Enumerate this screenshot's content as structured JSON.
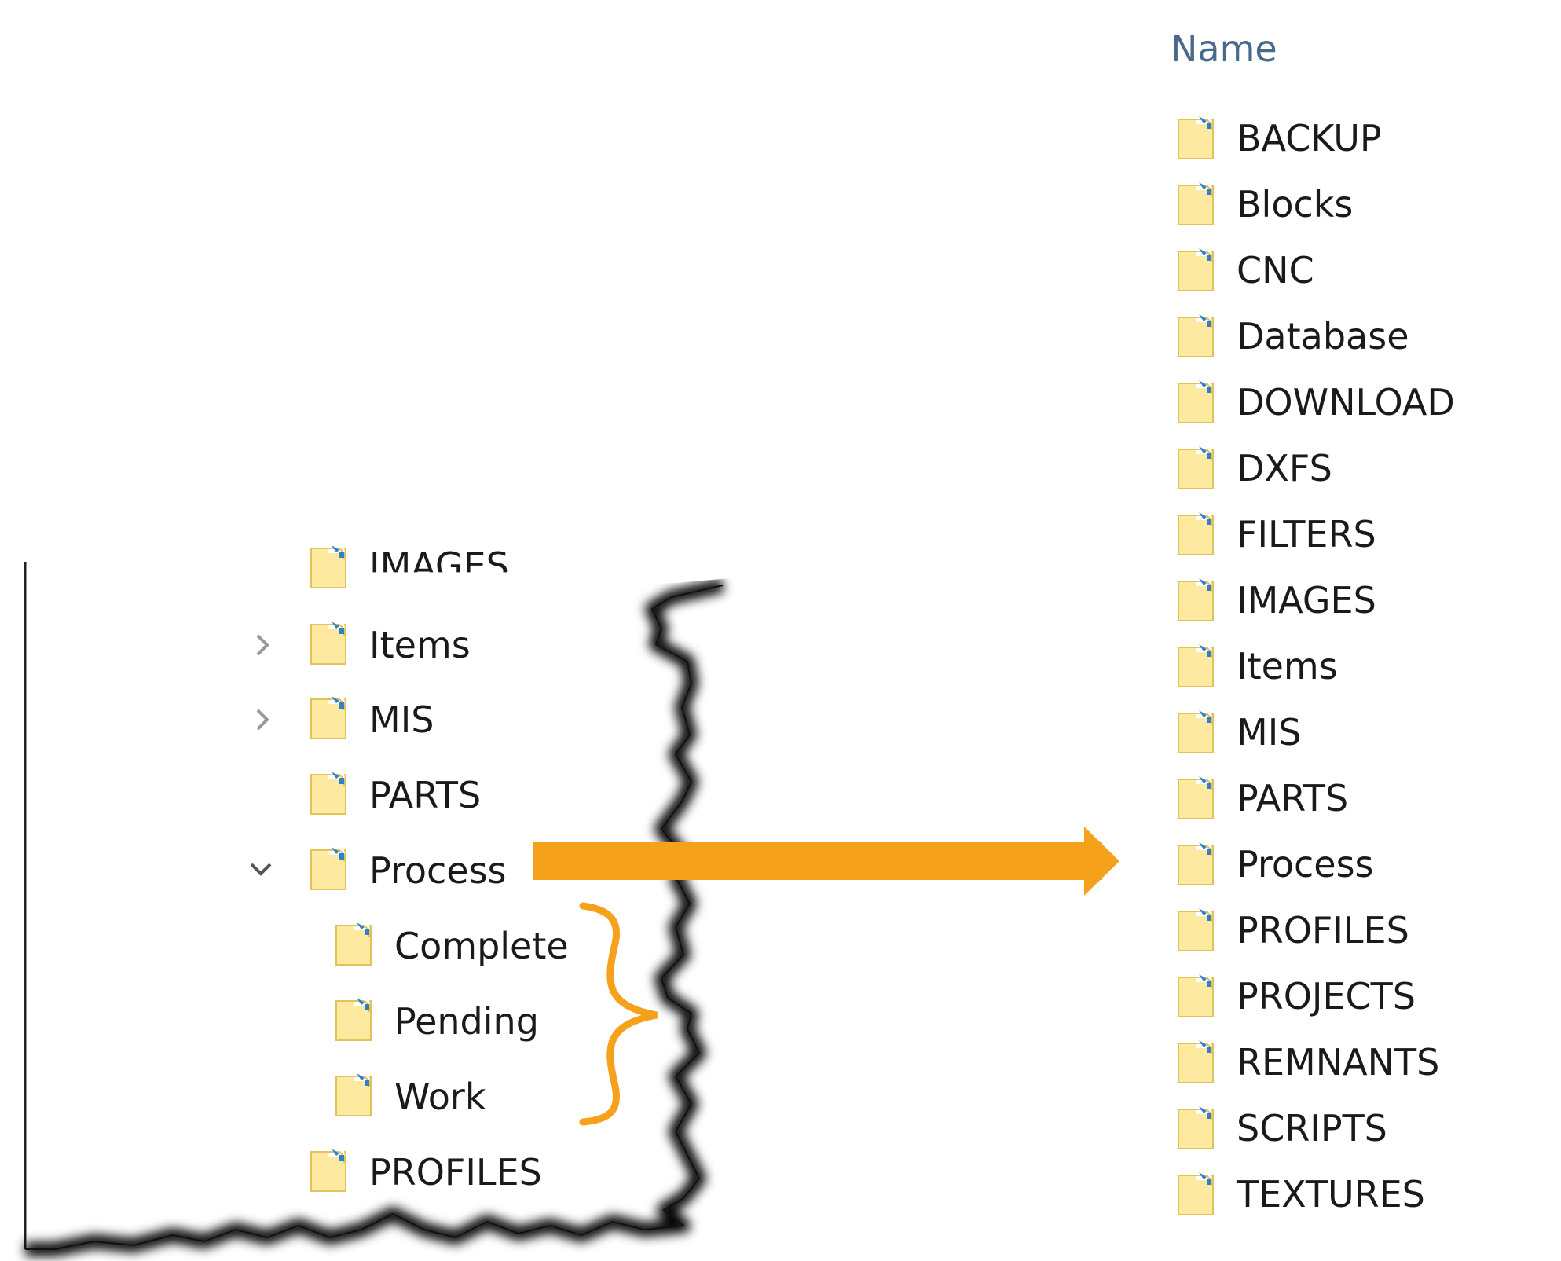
{
  "tree": {
    "partial_top_label": "IMAGES",
    "items": [
      {
        "label": "Items",
        "expander": "chevron-right"
      },
      {
        "label": "MIS",
        "expander": "chevron-right"
      },
      {
        "label": "PARTS",
        "expander": "none"
      },
      {
        "label": "Process",
        "expander": "chevron-down"
      },
      {
        "label": "Complete",
        "expander": "none"
      },
      {
        "label": "Pending",
        "expander": "none"
      },
      {
        "label": "Work",
        "expander": "none"
      },
      {
        "label": "PROFILES",
        "expander": "none"
      }
    ]
  },
  "list": {
    "column_header": "Name",
    "items": [
      "BACKUP",
      "Blocks",
      "CNC",
      "Database",
      "DOWNLOAD",
      "DXFS",
      "FILTERS",
      "IMAGES",
      "Items",
      "MIS",
      "PARTS",
      "Process",
      "PROFILES",
      "PROJECTS",
      "REMNANTS",
      "SCRIPTS",
      "TEXTURES"
    ]
  },
  "colors": {
    "accent_arrow": "#f5a11c",
    "folder_fill": "#fde9a0",
    "folder_edge": "#e2c25a",
    "folder_badge": "#2f7fd0",
    "header_text": "#4a6a8c"
  },
  "icons": [
    "folder-icon",
    "chevron-right-icon",
    "chevron-down-icon",
    "arrow-right-icon",
    "curly-brace-icon"
  ]
}
